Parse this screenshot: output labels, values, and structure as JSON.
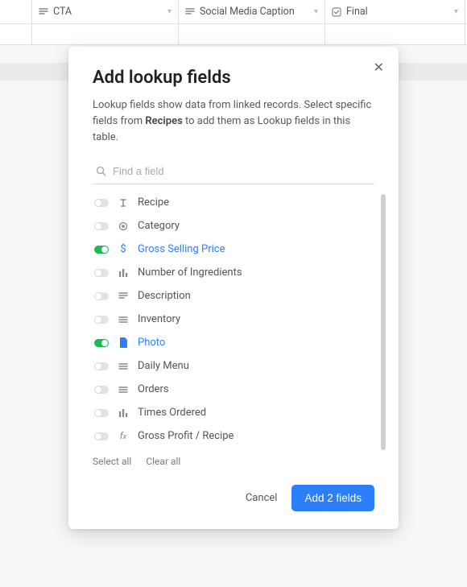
{
  "bg_columns": [
    {
      "label": "CTA",
      "icon": "longtext"
    },
    {
      "label": "Social Media Caption",
      "icon": "longtext"
    },
    {
      "label": "Final",
      "icon": "checkbox"
    }
  ],
  "modal": {
    "title": "Add lookup fields",
    "desc_before": "Lookup fields show data from linked records. Select specific fields from ",
    "linked_table": "Recipes",
    "desc_after": " to add them as Lookup fields in this table.",
    "search_placeholder": "Find a field",
    "fields": [
      {
        "label": "Recipe",
        "icon": "text",
        "on": false
      },
      {
        "label": "Category",
        "icon": "singleselect",
        "on": false
      },
      {
        "label": "Gross Selling Price",
        "icon": "currency",
        "on": true
      },
      {
        "label": "Number of Ingredients",
        "icon": "count",
        "on": false
      },
      {
        "label": "Description",
        "icon": "longtext",
        "on": false
      },
      {
        "label": "Inventory",
        "icon": "lines",
        "on": false
      },
      {
        "label": "Photo",
        "icon": "attachment",
        "on": true
      },
      {
        "label": "Daily Menu",
        "icon": "lines",
        "on": false
      },
      {
        "label": "Orders",
        "icon": "lines",
        "on": false
      },
      {
        "label": "Times Ordered",
        "icon": "count",
        "on": false
      },
      {
        "label": "Gross Profit / Recipe",
        "icon": "formula",
        "on": false
      }
    ],
    "select_all": "Select all",
    "clear_all": "Clear all",
    "cancel": "Cancel",
    "primary": "Add 2 fields"
  }
}
